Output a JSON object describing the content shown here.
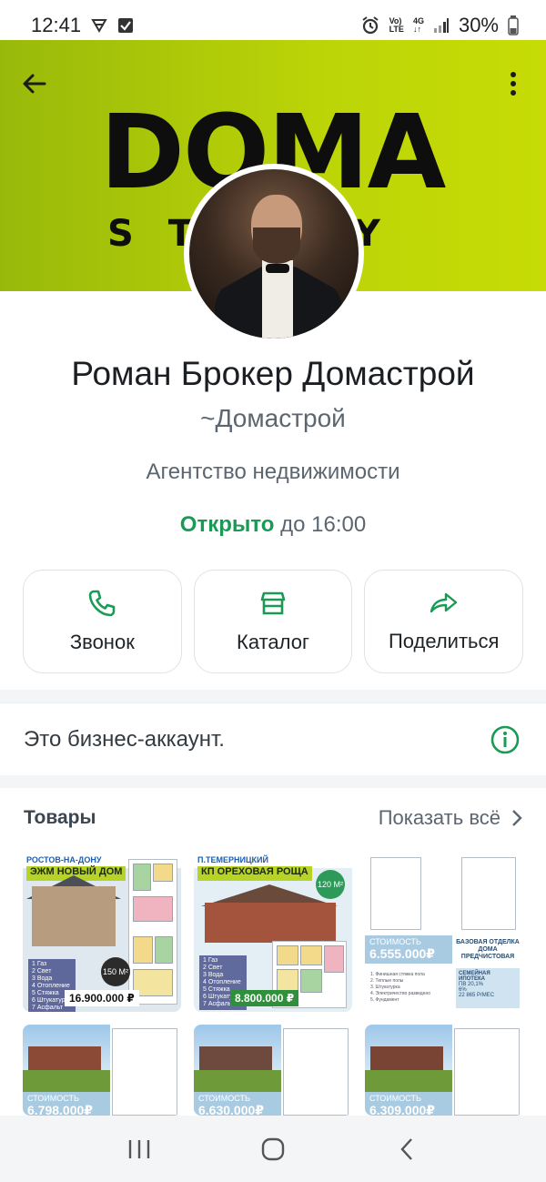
{
  "status_bar": {
    "time": "12:41",
    "network_top": "Vo)",
    "network_bottom": "LTE",
    "net_type": "4G",
    "battery": "30%"
  },
  "cover": {
    "brand_big": "DOMA",
    "brand_small": "STUDY",
    "accent": "#c7dc06"
  },
  "profile": {
    "name": "Роман Брокер Домастрой",
    "subname": "~Домастрой",
    "category": "Агентство недвижимости",
    "open_status": "Открыто",
    "hours_rest": " до 16:00"
  },
  "actions": [
    {
      "label": "Звонок",
      "icon": "phone-icon"
    },
    {
      "label": "Каталог",
      "icon": "storefront-icon"
    },
    {
      "label": "Поделиться",
      "icon": "forward-icon"
    }
  ],
  "business_note": {
    "text": "Это бизнес-аккаунт."
  },
  "goods": {
    "title": "Товары",
    "show_all": "Показать всё",
    "tiles": [
      {
        "top_text": "РОСТОВ-НА-ДОНУ",
        "banner": "ЭЖМ  НОВЫЙ ДОМ",
        "list": "1 Газ\n2 Свет\n3 Вода\n4 Отопление\n5 Стяжка\n6 Штукатурка\n7 Асфальт",
        "area": "150 М²",
        "price": "16.900.000 ₽"
      },
      {
        "top_text": "П.ТЕМЕРНИЦКИЙ",
        "banner": "КП ОРЕХОВАЯ РОЩА",
        "list": "1 Газ\n2 Свет\n3 Вода\n4 Отопление\n5 Стяжка\n6 Штукатурка\n7 Асфальт",
        "area": "120 М²",
        "price": "8.800.000 ₽"
      },
      {
        "cost_label": "СТОИМОСТЬ",
        "cost_value": "6.555.000₽",
        "finish": "БАЗОВАЯ ОТДЕЛКА ДОМА ПРЕДЧИСТОВАЯ",
        "notes": "1. Финишная стяжка пола\n2. Теплые полы\n3. Штукатурка\n4. Электричество разведено\n5. Фундамент",
        "mortgage_title": "СЕМЕЙНАЯ ИПОТЕКА",
        "mortgage_line1": "ПВ 20,1%",
        "mortgage_line2": "6%",
        "mortgage_line3": "22 865 Р/МЕС"
      },
      {
        "cost_label": "СТОИМОСТЬ",
        "cost_value": "6.798.000₽"
      },
      {
        "cost_label": "СТОИМОСТЬ",
        "cost_value": "6.630.000₽"
      },
      {
        "cost_label": "СТОИМОСТЬ",
        "cost_value": "6.309.000₽"
      }
    ]
  }
}
